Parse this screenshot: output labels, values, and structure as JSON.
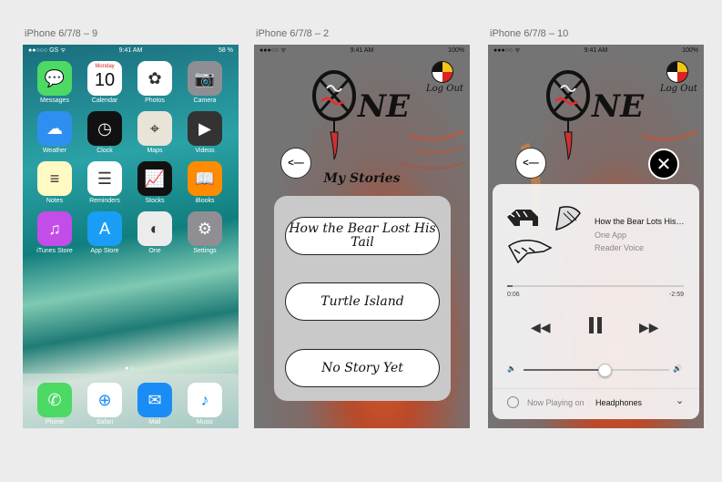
{
  "artboards": [
    {
      "label": "iPhone 6/7/8 – 9"
    },
    {
      "label": "iPhone 6/7/8 – 2"
    },
    {
      "label": "iPhone 6/7/8 – 10"
    }
  ],
  "home": {
    "status": {
      "carrier": "●●○○○ GS ᯤ",
      "time": "9:41 AM",
      "battery": "58 %"
    },
    "calendar": {
      "day": "Monday",
      "date": "10"
    },
    "apps": [
      {
        "label": "Messages",
        "icon": "messages-icon",
        "color": "#4cd964"
      },
      {
        "label": "Calendar",
        "icon": "calendar-icon",
        "color": "#ffffff"
      },
      {
        "label": "Photos",
        "icon": "photos-icon",
        "color": "#ffffff"
      },
      {
        "label": "Camera",
        "icon": "camera-icon",
        "color": "#8e8e93"
      },
      {
        "label": "Weather",
        "icon": "weather-icon",
        "color": "#2f8ff0"
      },
      {
        "label": "Clock",
        "icon": "clock-icon",
        "color": "#111111"
      },
      {
        "label": "Maps",
        "icon": "maps-icon",
        "color": "#e8e4d8"
      },
      {
        "label": "Videos",
        "icon": "videos-icon",
        "color": "#333333"
      },
      {
        "label": "Notes",
        "icon": "notes-icon",
        "color": "#fff9c4"
      },
      {
        "label": "Reminders",
        "icon": "reminders-icon",
        "color": "#ffffff"
      },
      {
        "label": "Stocks",
        "icon": "stocks-icon",
        "color": "#111111"
      },
      {
        "label": "iBooks",
        "icon": "ibooks-icon",
        "color": "#ff8c00"
      },
      {
        "label": "iTunes Store",
        "icon": "itunes-icon",
        "color": "#c34de8"
      },
      {
        "label": "App Store",
        "icon": "app-store-icon",
        "color": "#1a9ef5"
      },
      {
        "label": "One",
        "icon": "one-app-icon",
        "color": "#ececec"
      },
      {
        "label": "Settings",
        "icon": "settings-icon",
        "color": "#8e8e93"
      }
    ],
    "dock": [
      {
        "label": "Phone",
        "icon": "phone-icon",
        "color": "#4cd964"
      },
      {
        "label": "Safari",
        "icon": "safari-icon",
        "color": "#ffffff"
      },
      {
        "label": "Mail",
        "icon": "mail-icon",
        "color": "#1a8cf5"
      },
      {
        "label": "Music",
        "icon": "music-icon",
        "color": "#ffffff"
      }
    ]
  },
  "stories": {
    "status": {
      "carrier": "●●●○○ ᯤ",
      "time": "9:41 AM",
      "battery": "100%"
    },
    "logo_text": "NE",
    "logout": "Log Out",
    "back": "<—",
    "title": "My Stories",
    "items": [
      "How the Bear Lost His Tail",
      "Turtle Island",
      "No Story Yet"
    ]
  },
  "player": {
    "status": {
      "carrier": "●●●○○ ᯤ",
      "time": "9:41 AM",
      "battery": "100%"
    },
    "logo_text": "NE",
    "logout": "Log Out",
    "back": "<—",
    "track_title": "How the Bear Lots His…",
    "app_name": "One App",
    "voice": "Reader Voice",
    "elapsed": "0:06",
    "remaining": "-2:59",
    "progress": 0.03,
    "volume": 0.55,
    "now_playing_label": "Now Playing on",
    "device": "Headphones"
  }
}
